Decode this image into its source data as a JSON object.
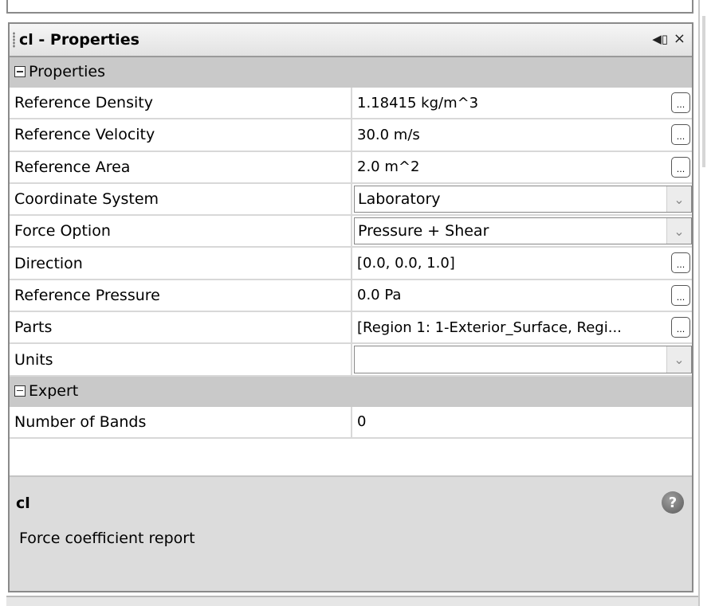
{
  "panel": {
    "title": "cl - Properties",
    "pin_icon": "speaker-pin-icon",
    "close_glyph": "×"
  },
  "categories": {
    "properties": "Properties",
    "expert": "Expert"
  },
  "properties": [
    {
      "name": "Reference Density",
      "value": "1.18415 kg/m^3",
      "editor": "button"
    },
    {
      "name": "Reference Velocity",
      "value": "30.0 m/s",
      "editor": "button"
    },
    {
      "name": "Reference Area",
      "value": "2.0 m^2",
      "editor": "button"
    },
    {
      "name": "Coordinate System",
      "value": "Laboratory",
      "editor": "dropdown"
    },
    {
      "name": "Force Option",
      "value": "Pressure + Shear",
      "editor": "dropdown"
    },
    {
      "name": "Direction",
      "value": "[0.0, 0.0, 1.0]",
      "editor": "button"
    },
    {
      "name": "Reference Pressure",
      "value": "0.0 Pa",
      "editor": "button"
    },
    {
      "name": "Parts",
      "value": "[Region 1: 1-Exterior_Surface, Regi...",
      "editor": "button"
    },
    {
      "name": "Units",
      "value": "",
      "editor": "dropdown"
    }
  ],
  "expert": [
    {
      "name": "Number of Bands",
      "value": "0"
    }
  ],
  "description": {
    "title": "cl",
    "text": "Force coefficient report",
    "help_glyph": "?"
  },
  "ellipsis_glyph": "...",
  "dropdown_glyph": "⌄"
}
